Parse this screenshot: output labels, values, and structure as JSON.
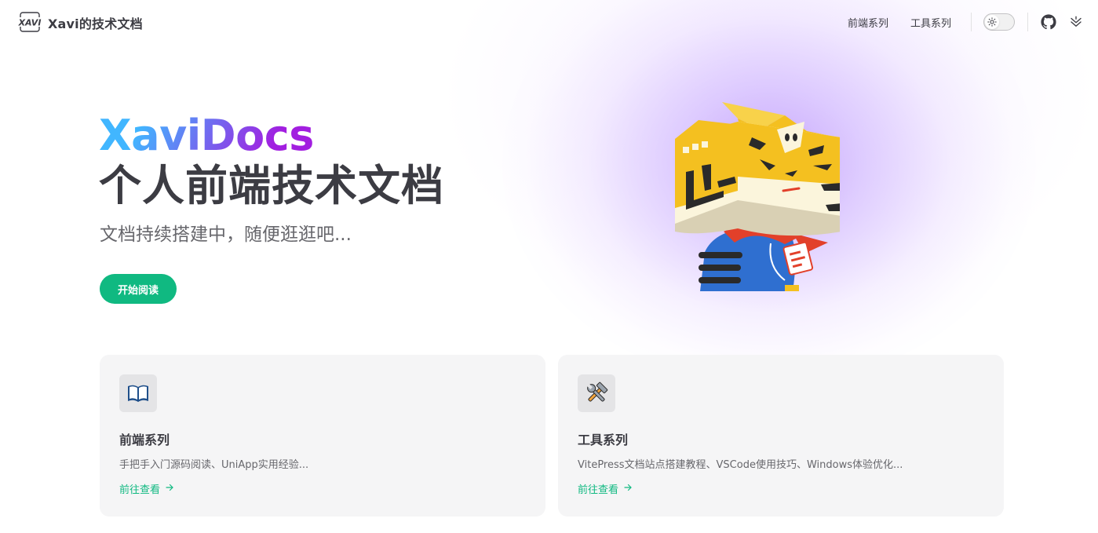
{
  "nav": {
    "logo_text": "XAVI",
    "site_title": "Xavi的技术文档",
    "links": [
      "前端系列",
      "工具系列"
    ]
  },
  "hero": {
    "name": "XaviDocs",
    "text": "个人前端技术文档",
    "tagline": "文档持续搭建中，随便逛逛吧...",
    "action_label": "开始阅读"
  },
  "features": [
    {
      "icon": "open-book-icon",
      "title": "前端系列",
      "details": "手把手入门源码阅读、UniApp实用经验...",
      "link_text": "前往查看"
    },
    {
      "icon": "hammer-wrench-icon",
      "title": "工具系列",
      "details": "VitePress文档站点搭建教程、VSCode使用技巧、Windows体验优化...",
      "link_text": "前往查看"
    }
  ],
  "colors": {
    "brand": "#10b981",
    "name_gradient_start": "#41b6ff",
    "name_gradient_end": "#a21ee0"
  }
}
